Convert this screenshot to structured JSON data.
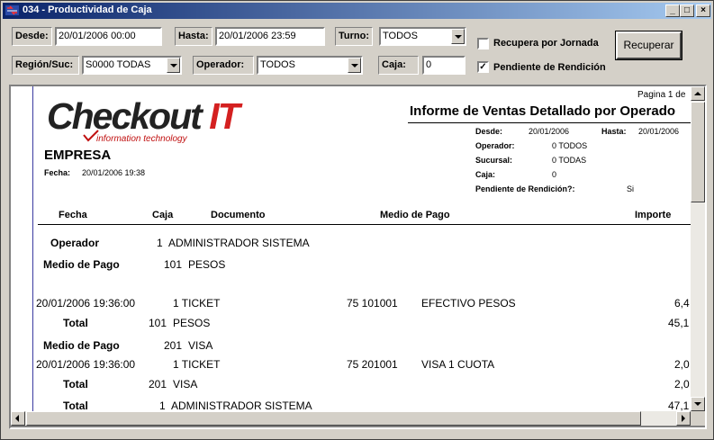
{
  "window": {
    "title": "034 - Productividad de Caja",
    "min_glyph": "_",
    "max_glyph": "□",
    "close_glyph": "×"
  },
  "filters": {
    "desde_label": "Desde:",
    "desde_value": "20/01/2006 00:00",
    "hasta_label": "Hasta:",
    "hasta_value": "20/01/2006 23:59",
    "turno_label": "Turno:",
    "turno_value": "TODOS",
    "region_label": "Región/Suc:",
    "region_value": "S0000 TODAS",
    "operador_label": "Operador:",
    "operador_value": "TODOS",
    "caja_label": "Caja:",
    "caja_value": "0",
    "recupera_jornada_label": "Recupera por Jornada",
    "recupera_jornada_checked": false,
    "pendiente_label": "Pendiente de Rendición",
    "pendiente_checked": true,
    "check_mark": "✓",
    "recuperar_button": "Recuperar"
  },
  "report": {
    "page_label": "Pagina 1 de",
    "logo_main": "Checkout ",
    "logo_it": "IT",
    "logo_sub": "information technology",
    "title": "Informe de Ventas Detallado por Operado",
    "company": "EMPRESA",
    "fecha_label": "Fecha:",
    "fecha_value": "20/01/2006 19:38",
    "params": {
      "desde_label": "Desde:",
      "desde_value": "20/01/2006",
      "hasta_label": "Hasta:",
      "hasta_value": "20/01/2006",
      "operador_label": "Operador:",
      "operador_value": "0 TODOS",
      "sucursal_label": "Sucursal:",
      "sucursal_value": "0 TODAS",
      "caja_label": "Caja:",
      "caja_value": "0",
      "pendiente_label": "Pendiente de Rendición?:",
      "pendiente_value": "Si"
    },
    "columns": {
      "fecha": "Fecha",
      "caja": "Caja",
      "documento": "Documento",
      "medio": "Medio de Pago",
      "importe": "Importe"
    },
    "operador_group": {
      "label": "Operador",
      "num": "1",
      "name": "ADMINISTRADOR SISTEMA"
    },
    "group1": {
      "label": "Medio de Pago",
      "num": "101",
      "name": "PESOS",
      "row": {
        "fecha": "20/01/2006  19:36:00",
        "doc": "1 TICKET",
        "code": "75 101001",
        "medio": "EFECTIVO PESOS",
        "importe": "6,4"
      },
      "total_label": "Total",
      "total_num": "101",
      "total_name": "PESOS",
      "total_value": "45,1"
    },
    "group2": {
      "label": "Medio de Pago",
      "num": "201",
      "name": "VISA",
      "row": {
        "fecha": "20/01/2006  19:36:00",
        "doc": "1 TICKET",
        "code": "75 201001",
        "medio": "VISA 1 CUOTA",
        "importe": "2,0"
      },
      "total_label": "Total",
      "total_num": "201",
      "total_name": "VISA",
      "total_value": "2,0"
    },
    "grand_total": {
      "label": "Total",
      "num": "1",
      "name": "ADMINISTRADOR SISTEMA",
      "value": "47,1"
    }
  }
}
